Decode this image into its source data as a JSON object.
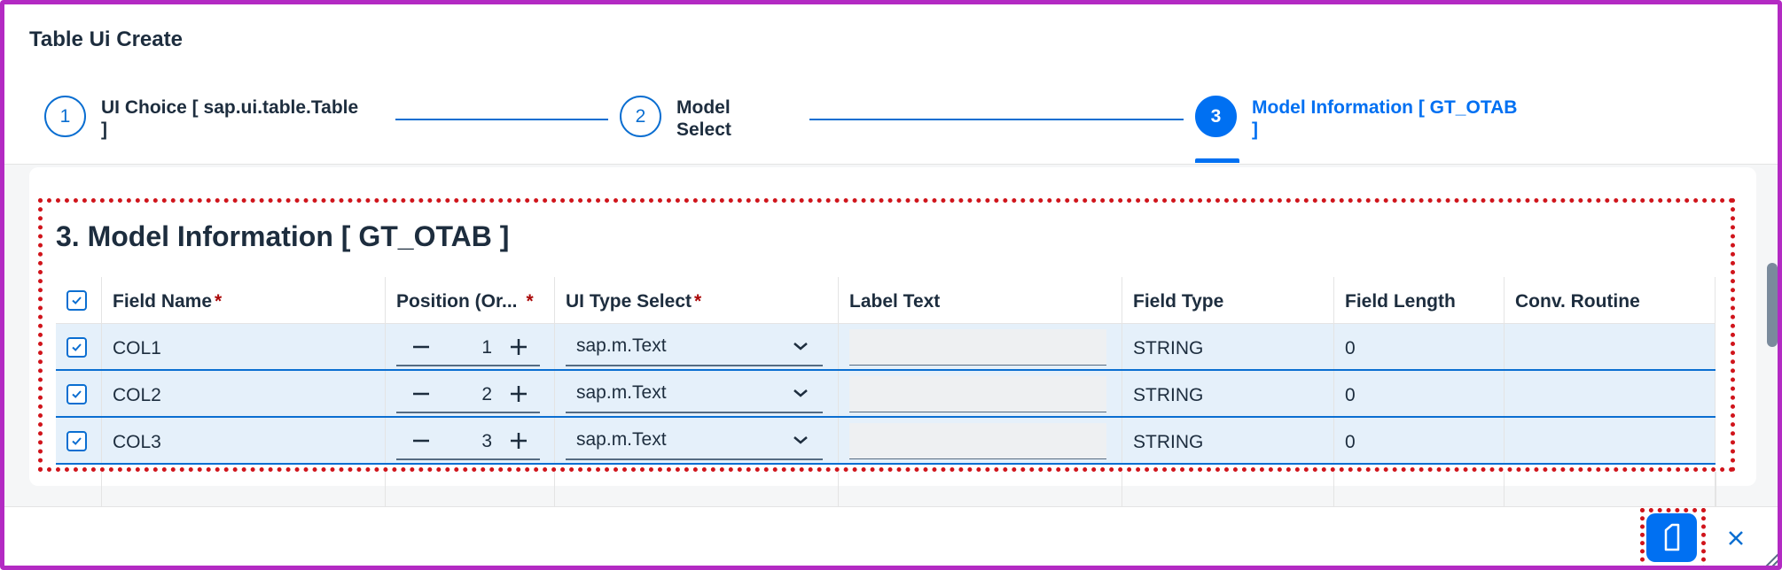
{
  "dialog": {
    "title": "Table Ui Create"
  },
  "wizard": {
    "steps": [
      {
        "number": "1",
        "title_line1": "UI Choice [ sap.ui.table.Table",
        "title_line2": "]"
      },
      {
        "number": "2",
        "title_line1": "Model",
        "title_line2": "Select"
      },
      {
        "number": "3",
        "title_line1": "Model Information [ GT_OTAB",
        "title_line2": "]",
        "active": true
      }
    ]
  },
  "section": {
    "title": "3. Model Information [ GT_OTAB ]"
  },
  "table": {
    "columns": [
      {
        "label": "Field Name",
        "required": "*"
      },
      {
        "label": "Position (Or...",
        "required": "*"
      },
      {
        "label": "UI Type Select",
        "required": "*"
      },
      {
        "label": "Label Text"
      },
      {
        "label": "Field Type"
      },
      {
        "label": "Field Length"
      },
      {
        "label": "Conv. Routine"
      }
    ],
    "rows": [
      {
        "field_name": "COL1",
        "position": "1",
        "ui_type": "sap.m.Text",
        "label_text": "",
        "field_type": "STRING",
        "field_length": "0",
        "conv_routine": ""
      },
      {
        "field_name": "COL2",
        "position": "2",
        "ui_type": "sap.m.Text",
        "label_text": "",
        "field_type": "STRING",
        "field_length": "0",
        "conv_routine": ""
      },
      {
        "field_name": "COL3",
        "position": "3",
        "ui_type": "sap.m.Text",
        "label_text": "",
        "field_type": "STRING",
        "field_length": "0",
        "conv_routine": ""
      }
    ]
  },
  "footer": {
    "action_icon": "document-icon",
    "close_icon": "close-icon"
  },
  "colors": {
    "brand_blue": "#0070f2",
    "row_selected": "#e5f0fa",
    "highlight_border": "#d0141b",
    "frame_border": "#b32ac3"
  }
}
